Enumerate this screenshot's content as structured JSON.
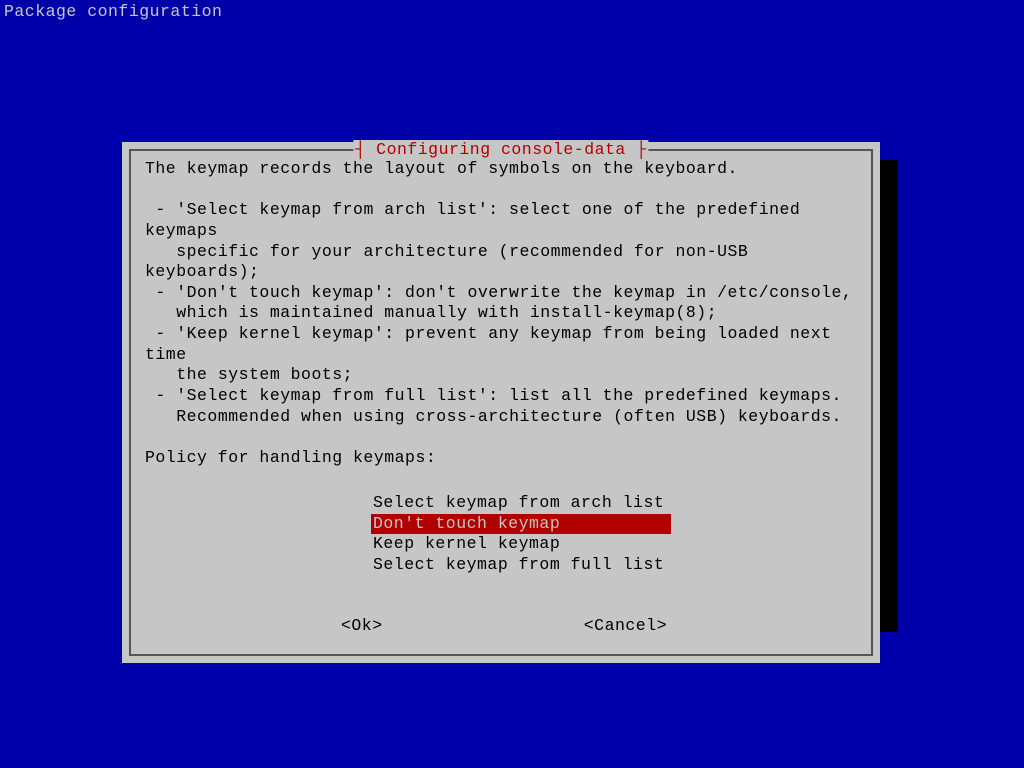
{
  "screen": {
    "title": "Package configuration"
  },
  "dialog": {
    "title": "┤ Configuring console-data ├",
    "intro": "The keymap records the layout of symbols on the keyboard.",
    "bullets": [
      " - 'Select keymap from arch list': select one of the predefined keymaps",
      "   specific for your architecture (recommended for non-USB keyboards);",
      " - 'Don't touch keymap': don't overwrite the keymap in /etc/console,",
      "   which is maintained manually with install-keymap(8);",
      " - 'Keep kernel keymap': prevent any keymap from being loaded next time",
      "   the system boots;",
      " - 'Select keymap from full list': list all the predefined keymaps.",
      "   Recommended when using cross-architecture (often USB) keyboards."
    ],
    "prompt": "Policy for handling keymaps:",
    "options": [
      {
        "label": "Select keymap from arch list",
        "selected": false
      },
      {
        "label": "Don't touch keymap",
        "selected": true
      },
      {
        "label": "Keep kernel keymap",
        "selected": false
      },
      {
        "label": "Select keymap from full list",
        "selected": false
      }
    ],
    "buttons": {
      "ok": "<Ok>",
      "cancel": "<Cancel>"
    }
  }
}
